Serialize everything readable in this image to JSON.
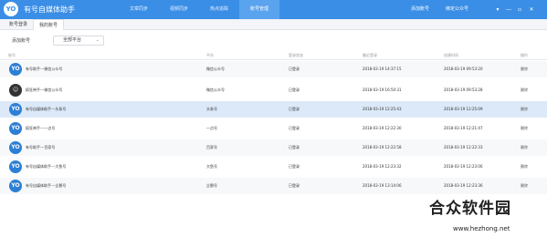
{
  "app": {
    "title": "有号自媒体助手",
    "logo_text": "YO"
  },
  "nav": {
    "items": [
      {
        "label": "文章同步"
      },
      {
        "label": "视频同步"
      },
      {
        "label": "热点追踪"
      },
      {
        "label": "账号管理"
      }
    ],
    "active_index": 3
  },
  "top_actions": {
    "add_account": "添加账号",
    "bind_wechat": "绑定公众号"
  },
  "tabs": [
    {
      "label": "账号登录"
    },
    {
      "label": "我的账号"
    }
  ],
  "toolbar": {
    "add_button": "添加账号",
    "platform_select": "全部平台"
  },
  "table": {
    "columns": [
      "账号",
      "平台",
      "登录状态",
      "最近登录",
      "创建时间",
      "操作"
    ],
    "rows": [
      {
        "account": "有号助手---微信公众号",
        "platform": "微信公众号",
        "status": "已登录",
        "last_login": "2018-03-19 14:37:15",
        "created": "2018-03-19 09:53:20",
        "action": "删除"
      },
      {
        "account": "疯狂带手---微信公众号",
        "platform": "微信公众号",
        "status": "已登录",
        "last_login": "2018-03-19 16:50:31",
        "created": "2018-03-19 09:53:28",
        "action": "删除"
      },
      {
        "account": "有号自媒体助手---头条号",
        "platform": "头条号",
        "status": "已登录",
        "last_login": "2018-03-19 12:25:43",
        "created": "2018-03-19 12:25:09",
        "action": "删除"
      },
      {
        "account": "疯狂带手---一点号",
        "platform": "一点号",
        "status": "已登录",
        "last_login": "2018-03-19 12:22:30",
        "created": "2018-03-19 12:21:47",
        "action": "删除"
      },
      {
        "account": "有号助手---百家号",
        "platform": "百家号",
        "status": "已登录",
        "last_login": "2018-03-19 12:22:58",
        "created": "2018-03-19 12:22:33",
        "action": "删除"
      },
      {
        "account": "有号自媒体助手---大鱼号",
        "platform": "大鱼号",
        "status": "已登录",
        "last_login": "2018-03-19 12:23:32",
        "created": "2018-03-19 12:23:06",
        "action": "删除"
      },
      {
        "account": "有号自媒体助手---企鹅号",
        "platform": "企鹅号",
        "status": "已登录",
        "last_login": "2018-03-19 13:14:06",
        "created": "2018-03-19 12:23:36",
        "action": "删除"
      }
    ]
  },
  "watermark": {
    "title": "合众软件园",
    "url": "www.hezhong.net"
  },
  "colors": {
    "topbar": "#3a8ee6",
    "selected_row": "#dce9f8"
  }
}
